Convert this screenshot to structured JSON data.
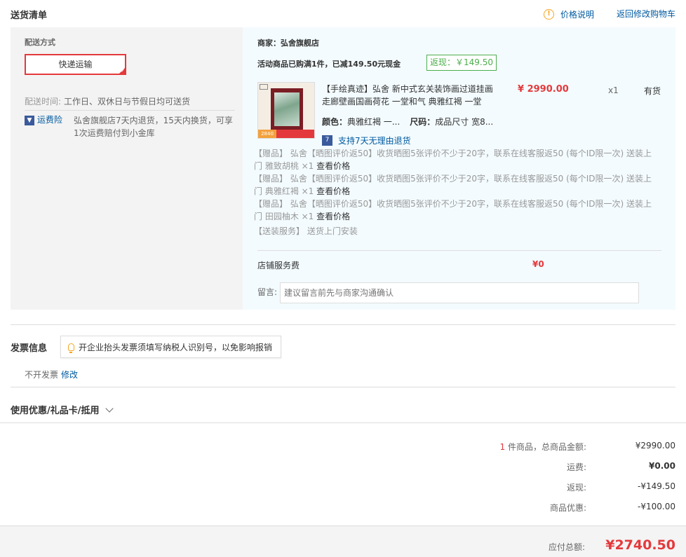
{
  "header": {
    "title": "送货清单",
    "price_note": "价格说明",
    "back_to_cart": "返回修改购物车"
  },
  "shipping": {
    "label": "配送方式",
    "method": "快递运输",
    "time_label": "配送时间:",
    "time_value": "工作日、双休日与节假日均可送货",
    "insurance_link": "运费险",
    "insurance_desc": "弘舍旗舰店7天内退货，15天内换货，可享1次运费赔付到小金库"
  },
  "shop": {
    "merchant": "商家：弘舍旗舰店",
    "promo": "活动商品已购满1件，已减149.50元现金",
    "rebate_badge": "返现：￥149.50",
    "product": {
      "name": "【手绘真迹】弘舍 新中式玄关装饰画过道挂画走廊壁画国画荷花 一堂和气 典雅红褐 一堂",
      "price": "¥ 2990.00",
      "qty": "x1",
      "stock": "有货",
      "color_label": "颜色：",
      "color_value": "典雅红褐 一...",
      "size_label": "尺码：",
      "size_value": "成品尺寸 宽8...",
      "thumb_price": "2840",
      "return_icon": "7",
      "return_policy": "支持7天无理由退货"
    },
    "gifts": [
      {
        "text": "【赠品】  弘舍【晒图评价返50】收货晒图5张评价不少于20字，联系在线客服返50 (每个ID限一次)  送装上门 雅致胡桃 ×1",
        "link": "查看价格"
      },
      {
        "text": "【赠品】  弘舍【晒图评价返50】收货晒图5张评价不少于20字，联系在线客服返50 (每个ID限一次)  送装上门 典雅红褐 ×1",
        "link": "查看价格"
      },
      {
        "text": "【赠品】  弘舍【晒图评价返50】收货晒图5张评价不少于20字，联系在线客服返50 (每个ID限一次)  送装上门 田园柚木 ×1",
        "link": "查看价格"
      }
    ],
    "service": "【送装服务】  送货上门安装",
    "service_fee_label": "店铺服务费",
    "service_fee_value": "¥0",
    "message_label": "留言:",
    "message_placeholder": "建议留言前先与商家沟通确认"
  },
  "invoice": {
    "title": "发票信息",
    "tip": "开企业抬头发票须填写纳税人识别号，以免影响报销",
    "status": "不开发票",
    "edit": "修改"
  },
  "coupon": {
    "label": "使用优惠/礼品卡/抵用"
  },
  "summary": {
    "count": "1",
    "count_label": " 件商品，总商品金额:",
    "goods_total": "¥2990.00",
    "shipping_label": "运费:",
    "shipping_value": "¥0.00",
    "rebate_label": "返现:",
    "rebate_value": "-¥149.50",
    "discount_label": "商品优惠:",
    "discount_value": "-¥100.00",
    "payable_label": "应付总额:",
    "payable_value": "¥2740.50"
  },
  "colors": {
    "accent_red": "#e4393c",
    "link_blue": "#005aa0",
    "rebate_green": "#4cae4c",
    "warning_orange": "#f5a623"
  }
}
